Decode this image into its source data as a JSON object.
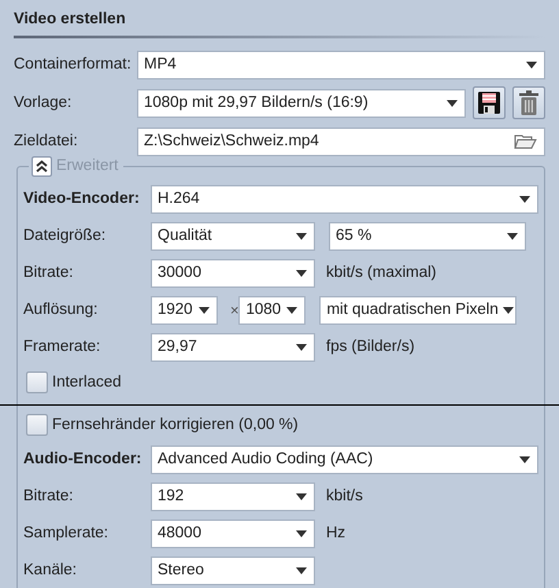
{
  "title": "Video erstellen",
  "fields": [
    {
      "kind": "dropdown",
      "label": "Containerformat:",
      "value": "MP4"
    },
    {
      "kind": "preset",
      "label": "Vorlage:",
      "value": "1080p mit 29,97 Bildern/s (16:9)"
    },
    {
      "kind": "file",
      "label": "Zieldatei:",
      "value": "Z:\\Schweiz\\Schweiz.mp4"
    }
  ],
  "advanced": {
    "legend": "Erweitert",
    "expanded": true,
    "rows": [
      {
        "kind": "encoder",
        "label": "Video-Encoder:",
        "value": "H.264"
      },
      {
        "kind": "controls",
        "label": "Dateigröße:",
        "controls": [
          {
            "kind": "medium",
            "value": "Qualität"
          },
          {
            "kind": "wide",
            "value": "65 %"
          }
        ]
      },
      {
        "kind": "controls",
        "label": "Bitrate:",
        "controls": [
          {
            "kind": "medium",
            "value": "30000"
          },
          {
            "kind": "unit",
            "value": "kbit/s (maximal)"
          }
        ]
      },
      {
        "kind": "controls",
        "label": "Auflösung:",
        "controls": [
          {
            "kind": "small",
            "value": "1920"
          },
          {
            "kind": "times",
            "value": "×"
          },
          {
            "kind": "small",
            "value": "1080"
          },
          {
            "kind": "wide",
            "value": "mit quadratischen Pixeln"
          }
        ]
      },
      {
        "kind": "controls",
        "label": "Framerate:",
        "controls": [
          {
            "kind": "medium",
            "value": "29,97"
          },
          {
            "kind": "unit",
            "value": "fps (Bilder/s)"
          }
        ]
      },
      {
        "kind": "checkbox",
        "label": "Interlaced",
        "checked": false
      },
      {
        "kind": "separator"
      },
      {
        "kind": "checkbox",
        "label": "Fernsehränder korrigieren (0,00 %)",
        "checked": false
      },
      {
        "kind": "encoder",
        "label": "Audio-Encoder:",
        "value": "Advanced Audio Coding (AAC)"
      },
      {
        "kind": "controls",
        "label": "Bitrate:",
        "controls": [
          {
            "kind": "medium",
            "value": "192"
          },
          {
            "kind": "unit",
            "value": "kbit/s"
          }
        ]
      },
      {
        "kind": "controls",
        "label": "Samplerate:",
        "controls": [
          {
            "kind": "medium",
            "value": "48000"
          },
          {
            "kind": "unit",
            "value": "Hz"
          }
        ]
      },
      {
        "kind": "controls",
        "label": "Kanäle:",
        "controls": [
          {
            "kind": "medium",
            "value": "Stereo"
          }
        ]
      }
    ]
  }
}
